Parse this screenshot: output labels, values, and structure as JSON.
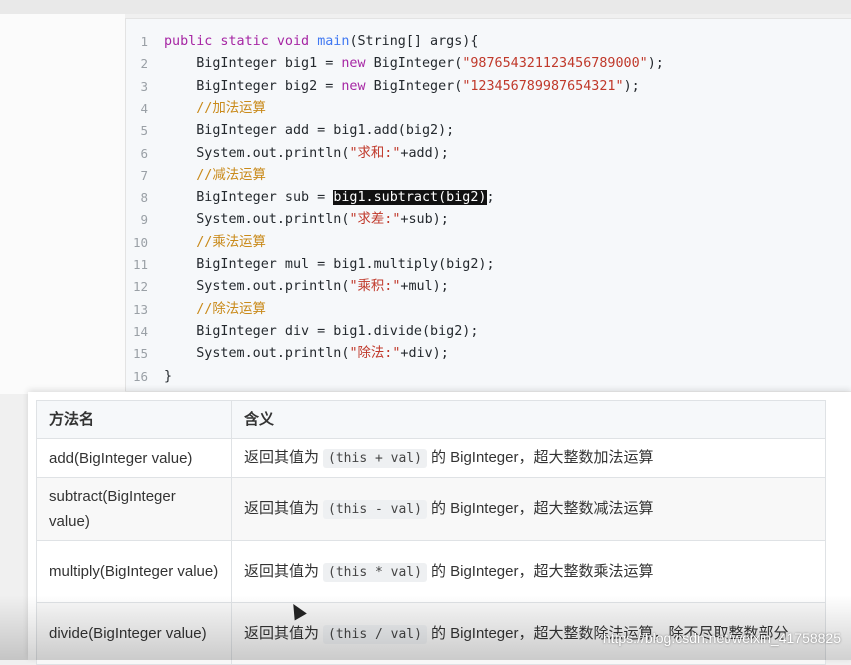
{
  "code": {
    "lines": [
      {
        "n": "1",
        "tokens": [
          [
            "kw",
            "public static void "
          ],
          [
            "fn",
            "main"
          ],
          [
            "",
            "(String[] args){"
          ]
        ]
      },
      {
        "n": "2",
        "tokens": [
          [
            "",
            "    BigInteger big1 = "
          ],
          [
            "kw",
            "new "
          ],
          [
            "",
            "BigInteger("
          ],
          [
            "str",
            "\"987654321123456789000\""
          ],
          [
            "",
            ");"
          ]
        ]
      },
      {
        "n": "3",
        "tokens": [
          [
            "",
            "    BigInteger big2 = "
          ],
          [
            "kw",
            "new "
          ],
          [
            "",
            "BigInteger("
          ],
          [
            "str",
            "\"123456789987654321\""
          ],
          [
            "",
            ");"
          ]
        ]
      },
      {
        "n": "4",
        "tokens": [
          [
            "cm",
            "    //加法运算"
          ]
        ]
      },
      {
        "n": "5",
        "tokens": [
          [
            "",
            "    BigInteger add = big1.add(big2);"
          ]
        ]
      },
      {
        "n": "6",
        "tokens": [
          [
            "",
            "    System.out.println("
          ],
          [
            "str",
            "\"求和:\""
          ],
          [
            "",
            "+add);"
          ]
        ]
      },
      {
        "n": "7",
        "tokens": [
          [
            "cm",
            "    //减法运算"
          ]
        ]
      },
      {
        "n": "8",
        "tokens": [
          [
            "",
            "    BigInteger sub = "
          ],
          [
            "sel",
            "big1.subtract(big2)"
          ],
          [
            "",
            ";"
          ]
        ]
      },
      {
        "n": "9",
        "tokens": [
          [
            "",
            "    System.out.println("
          ],
          [
            "str",
            "\"求差:\""
          ],
          [
            "",
            "+sub);"
          ]
        ]
      },
      {
        "n": "10",
        "tokens": [
          [
            "cm",
            "    //乘法运算"
          ]
        ]
      },
      {
        "n": "11",
        "tokens": [
          [
            "",
            "    BigInteger mul = big1.multiply(big2);"
          ]
        ]
      },
      {
        "n": "12",
        "tokens": [
          [
            "",
            "    System.out.println("
          ],
          [
            "str",
            "\"乘积:\""
          ],
          [
            "",
            "+mul);"
          ]
        ]
      },
      {
        "n": "13",
        "tokens": [
          [
            "cm",
            "    //除法运算"
          ]
        ]
      },
      {
        "n": "14",
        "tokens": [
          [
            "",
            "    BigInteger div = big1.divide(big2);"
          ]
        ]
      },
      {
        "n": "15",
        "tokens": [
          [
            "",
            "    System.out.println("
          ],
          [
            "str",
            "\"除法:\""
          ],
          [
            "",
            "+div);"
          ]
        ]
      },
      {
        "n": "16",
        "tokens": [
          [
            "",
            "}"
          ]
        ]
      }
    ]
  },
  "table": {
    "headers": [
      "方法名",
      "含义"
    ],
    "rows": [
      {
        "method": "add(BigInteger value)",
        "prefix": "返回其值为",
        "code": "(this + val)",
        "suffix": "的 BigInteger，超大整数加法运算"
      },
      {
        "method": "subtract(BigInteger value)",
        "prefix": "返回其值为",
        "code": "(this - val)",
        "suffix": "的 BigInteger，超大整数减法运算"
      },
      {
        "method": "multiply(BigInteger value)",
        "prefix": "返回其值为",
        "code": "(this * val)",
        "suffix": "的 BigInteger，超大整数乘法运算"
      },
      {
        "method": "divide(BigInteger value)",
        "prefix": "返回其值为",
        "code": "(this / val)",
        "suffix": "的 BigInteger，超大整数除法运算，除不尽取整数部分"
      }
    ]
  },
  "watermark": "https://blog.csdn.net/weixin_41758825"
}
